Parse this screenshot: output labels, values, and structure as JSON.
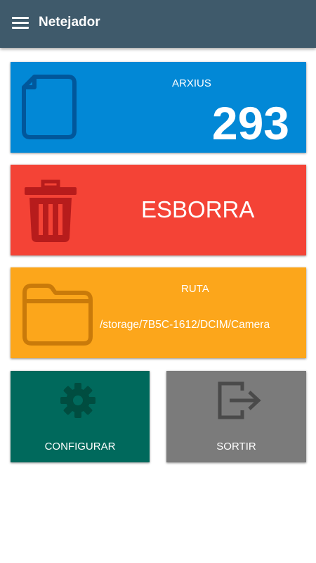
{
  "app": {
    "title": "Netejador"
  },
  "colors": {
    "appbar": "#3f5a6b",
    "files_card": "#0288d6",
    "delete_card": "#f44336",
    "path_card": "#fca61b",
    "config_card": "#00695c",
    "exit_card": "#7b7b7b"
  },
  "icons": {
    "menu": "menu-icon",
    "files": "document-icon",
    "delete": "trash-icon",
    "path": "folder-icon",
    "config": "gear-icon",
    "exit": "exit-icon"
  },
  "files": {
    "label": "ARXIUS",
    "count": "293"
  },
  "delete": {
    "label": "ESBORRA"
  },
  "path": {
    "label": "RUTA",
    "value": "/storage/7B5C-1612/DCIM/Camera"
  },
  "config": {
    "label": "CONFIGURAR"
  },
  "exit": {
    "label": "SORTIR"
  }
}
